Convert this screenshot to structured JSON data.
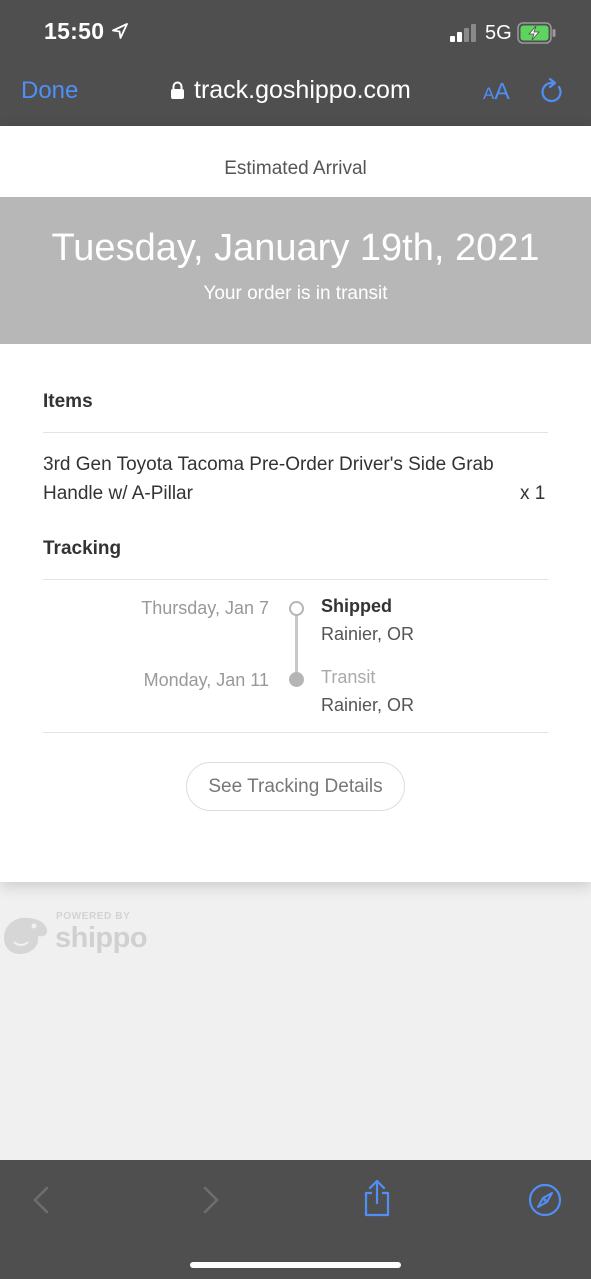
{
  "status_bar": {
    "time": "15:50",
    "network": "5G"
  },
  "browser": {
    "done_label": "Done",
    "url": "track.goshippo.com",
    "aa_small": "A",
    "aa_large": "A"
  },
  "page": {
    "estimated_label": "Estimated Arrival",
    "arrival_date": "Tuesday, January 19th, 2021",
    "order_status": "Your order is in transit",
    "items_title": "Items",
    "item": {
      "name": "3rd Gen Toyota Tacoma Pre-Order Driver's Side Grab Handle w/ A-Pillar",
      "qty": "x 1"
    },
    "tracking_title": "Tracking",
    "events": [
      {
        "date": "Thursday, Jan 7",
        "status": "Shipped",
        "location": "Rainier, OR"
      },
      {
        "date": "Monday, Jan 11",
        "status": "Transit",
        "location": "Rainier, OR"
      }
    ],
    "details_button": "See Tracking Details"
  },
  "footer": {
    "powered_by": "POWERED BY",
    "brand": "shippo"
  },
  "colors": {
    "accent": "#4f8ff7",
    "chrome": "#4f4f4f",
    "band": "#b7b7b7"
  },
  "icons": [
    "location-arrow-icon",
    "signal-icon",
    "battery-charging-icon",
    "lock-icon",
    "reload-icon",
    "back-icon",
    "forward-icon",
    "share-icon",
    "compass-icon",
    "shippo-penguin-logo"
  ]
}
